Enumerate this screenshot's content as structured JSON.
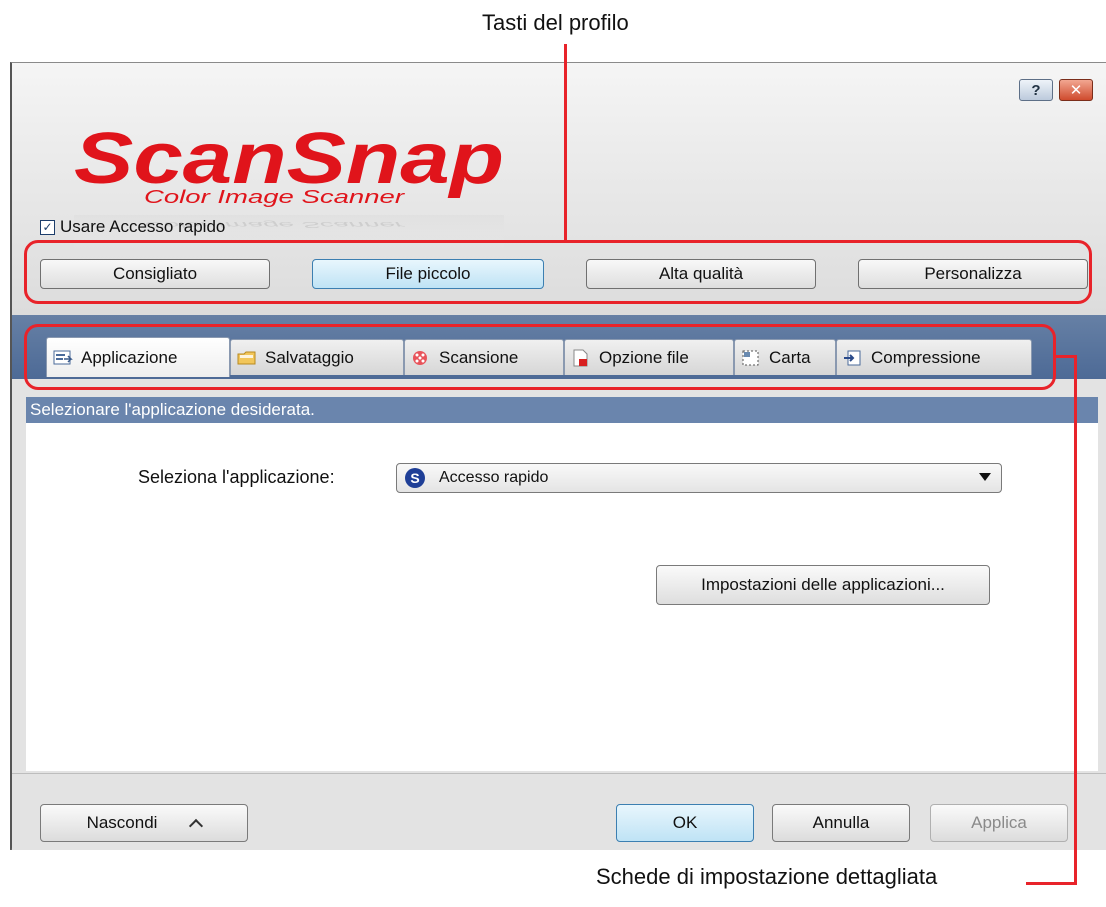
{
  "annotations": {
    "top": "Tasti del profilo",
    "bottom": "Schede di impostazione dettagliata"
  },
  "brand": {
    "name": "ScanSnap",
    "tagline": "Color Image Scanner",
    "color": "#e0141b"
  },
  "title_bar": {
    "help_glyph": "?",
    "close_glyph": "✕"
  },
  "quick_menu": {
    "label": "Usare Accesso rapido",
    "checked": true
  },
  "profiles": [
    "Consigliato",
    "File piccolo",
    "Alta qualità",
    "Personalizza"
  ],
  "tabs": [
    {
      "label": "Applicazione",
      "icon": "application-icon"
    },
    {
      "label": "Salvataggio",
      "icon": "folder-icon"
    },
    {
      "label": "Scansione",
      "icon": "scan-icon"
    },
    {
      "label": "Opzione file",
      "icon": "file-pdf-icon"
    },
    {
      "label": "Carta",
      "icon": "paper-icon"
    },
    {
      "label": "Compressione",
      "icon": "compression-icon"
    }
  ],
  "status_text": "Selezionare l'applicazione desiderata.",
  "application": {
    "label": "Seleziona l'applicazione:",
    "selected": "Accesso rapido",
    "settings_button": "Impostazioni delle applicazioni..."
  },
  "footer": {
    "hide_label": "Nascondi",
    "ok_label": "OK",
    "cancel_label": "Annulla",
    "apply_label": "Applica"
  }
}
